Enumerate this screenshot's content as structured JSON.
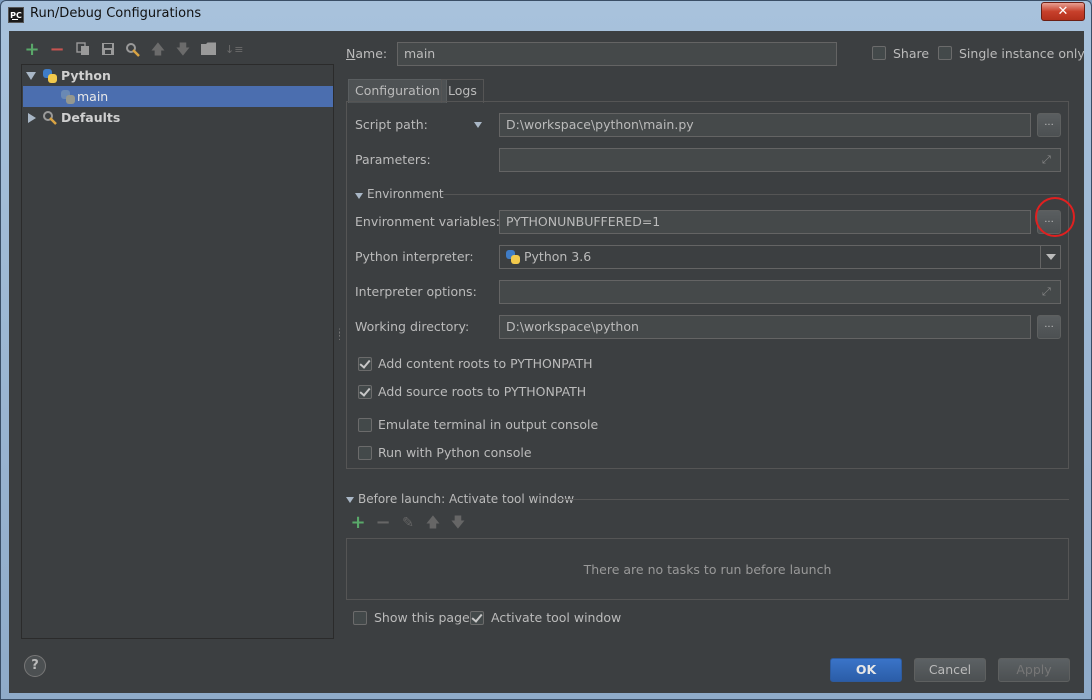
{
  "window": {
    "title": "Run/Debug Configurations",
    "logo_text": "PC",
    "close_glyph": "✕"
  },
  "toolbar": {
    "icons": [
      "add-icon",
      "remove-icon",
      "copy-icon",
      "save-icon",
      "edit-defaults-icon",
      "move-up-icon",
      "move-down-icon",
      "folder-icon",
      "sort-icon"
    ]
  },
  "tree": {
    "python_label": "Python",
    "main_label": "main",
    "defaults_label": "Defaults"
  },
  "form": {
    "name_label": "Name:",
    "name_value": "main",
    "share_label": "Share",
    "single_instance_label": "Single instance only",
    "share_checked": false,
    "single_instance_checked": false
  },
  "tabs": [
    "Configuration",
    "Logs"
  ],
  "config": {
    "script_path_label": "Script path:",
    "script_path_value": "D:\\workspace\\python\\main.py",
    "parameters_label": "Parameters:",
    "parameters_value": "",
    "environment_section": "Environment",
    "env_vars_label": "Environment variables:",
    "env_vars_value": "PYTHONUNBUFFERED=1",
    "interpreter_label": "Python interpreter:",
    "interpreter_value": "Python 3.6",
    "interp_options_label": "Interpreter options:",
    "interp_options_value": "",
    "working_dir_label": "Working directory:",
    "working_dir_value": "D:\\workspace\\python",
    "browse_glyph": "...",
    "checkboxes": [
      {
        "label": "Add content roots to PYTHONPATH",
        "checked": true
      },
      {
        "label": "Add source roots to PYTHONPATH",
        "checked": true
      },
      {
        "label": "Emulate terminal in output console",
        "checked": false
      },
      {
        "label": "Run with Python console",
        "checked": false
      }
    ]
  },
  "before_launch": {
    "title": "Before launch: Activate tool window",
    "empty_text": "There are no tasks to run before launch",
    "show_page_label": "Show this page",
    "activate_label": "Activate tool window",
    "show_page_checked": false,
    "activate_checked": true
  },
  "buttons": {
    "ok": "OK",
    "cancel": "Cancel",
    "apply": "Apply",
    "help": "?"
  },
  "colors": {
    "background": "#3c3f41",
    "selection": "#4b6eaf",
    "accent_green": "#59a869",
    "accent_red": "#c75450",
    "highlight_circle": "#e02020"
  }
}
